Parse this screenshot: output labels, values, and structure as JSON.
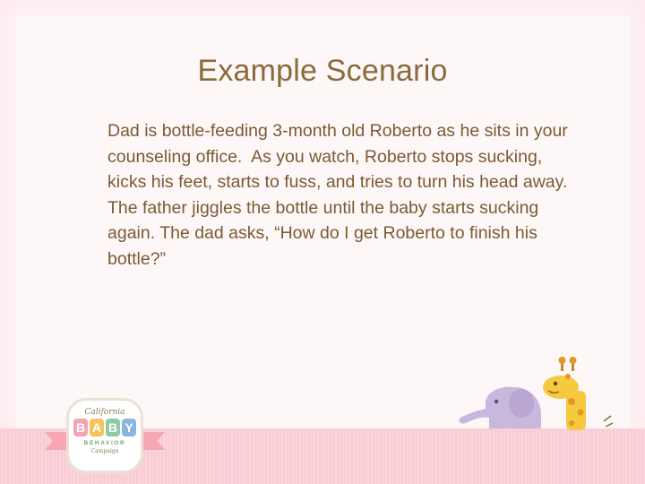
{
  "slide": {
    "title": "Example Scenario",
    "body": "Dad is bottle-feeding 3-month old Roberto as he sits in your counseling office.  As you watch, Roberto stops sucking, kicks his feet, starts to fuss, and tries to turn his head away.  The father jiggles the bottle until the baby starts sucking again. The dad asks, “How do I get Roberto to finish his bottle?”"
  },
  "logo": {
    "line1": "California",
    "letters": [
      "B",
      "A",
      "B",
      "Y"
    ],
    "letter_colors": [
      "#f4a3b2",
      "#f6c35c",
      "#8fc9a6",
      "#8ab6de"
    ],
    "line2": "BEHAVIOR",
    "line3": "Campaign"
  },
  "illustration": {
    "icons": [
      "elephant-icon",
      "giraffe-icon"
    ],
    "colors": {
      "elephant": "#c9b8dd",
      "giraffe": "#f6c940",
      "giraffe_spots": "#e2972c"
    }
  }
}
